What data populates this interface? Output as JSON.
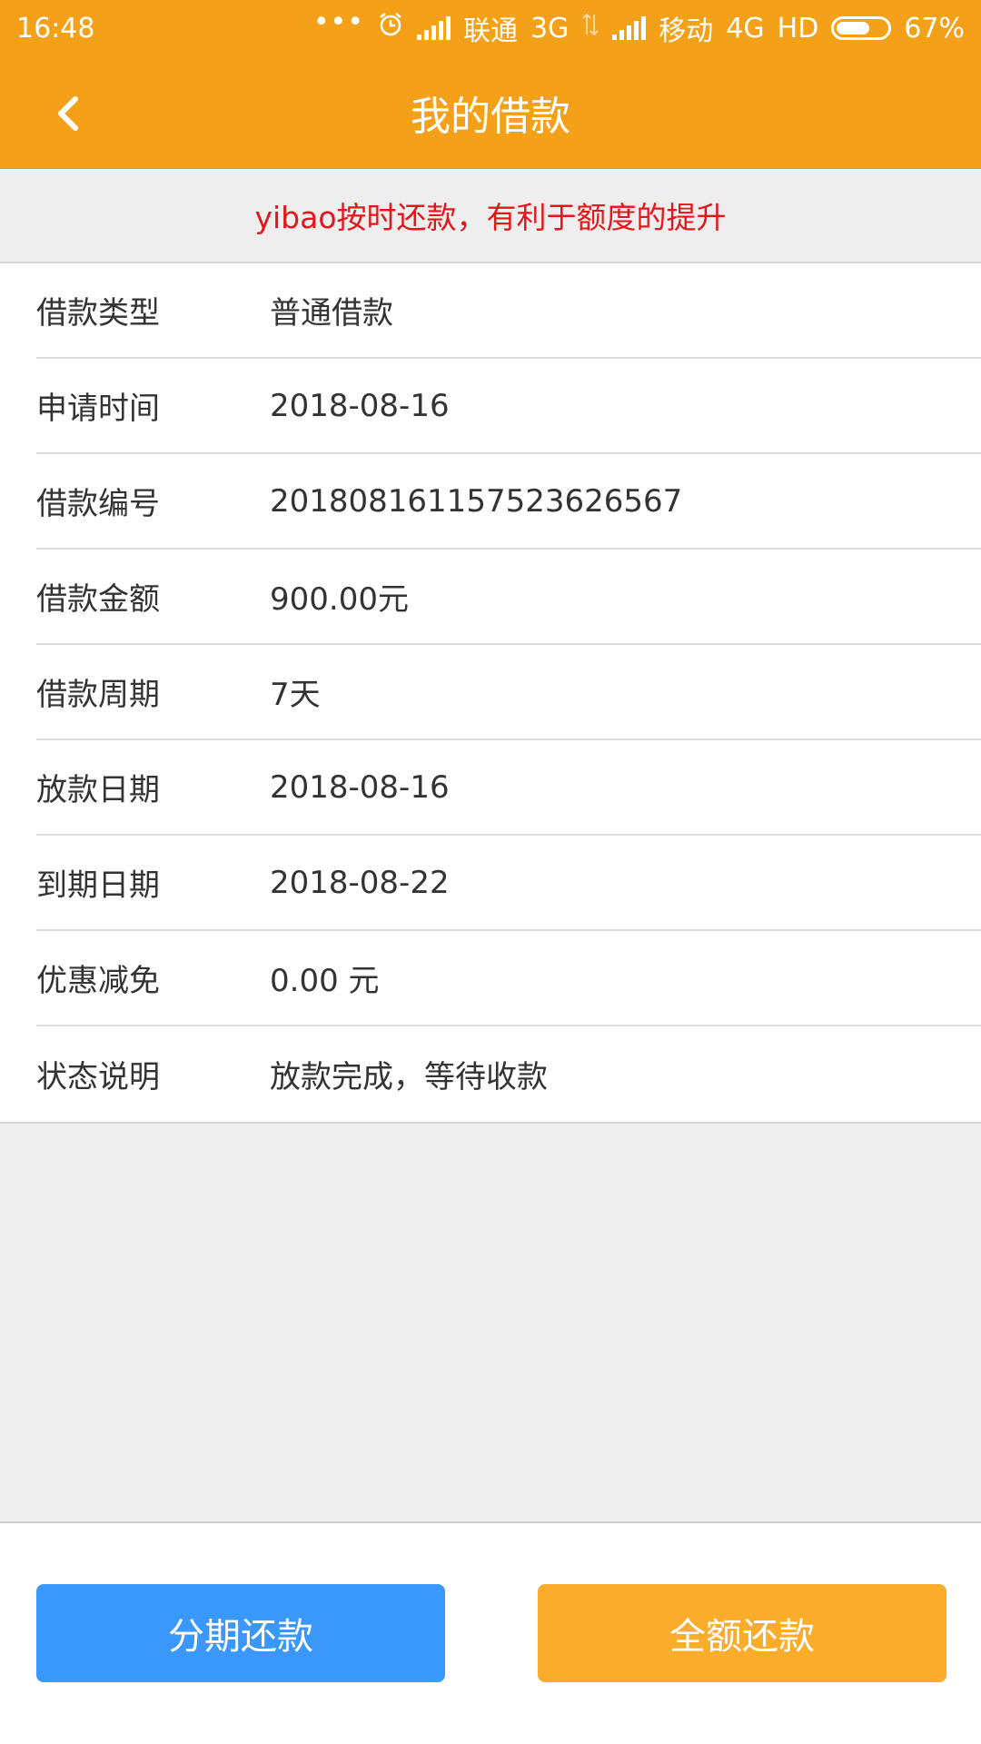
{
  "status_bar": {
    "time": "16:48",
    "dots": "•••",
    "carrier1": "联通",
    "network1": "3G",
    "carrier2": "移动",
    "network2": "4G",
    "hd": "HD",
    "battery": "67%",
    "battery_level": 0.67
  },
  "header": {
    "title": "我的借款"
  },
  "notice": {
    "text": "yibao按时还款，有利于额度的提升"
  },
  "details": [
    {
      "label": "借款类型",
      "value": "普通借款"
    },
    {
      "label": "申请时间",
      "value": "2018-08-16"
    },
    {
      "label": "借款编号",
      "value": "20180816115752362656 7"
    },
    {
      "label": "借款金额",
      "value": "900.00元"
    },
    {
      "label": "借款周期",
      "value": "7天"
    },
    {
      "label": "放款日期",
      "value": "2018-08-16"
    },
    {
      "label": "到期日期",
      "value": "2018-08-22"
    },
    {
      "label": "优惠减免",
      "value": "0.00 元"
    },
    {
      "label": "状态说明",
      "value": "放款完成，等待收款"
    }
  ],
  "actions": {
    "installment_label": "分期还款",
    "full_label": "全额还款"
  },
  "colors": {
    "header": "#f5a019",
    "notice_text": "#e5161b",
    "installment_button": "#3a97fc",
    "full_button": "#fbac2a"
  }
}
